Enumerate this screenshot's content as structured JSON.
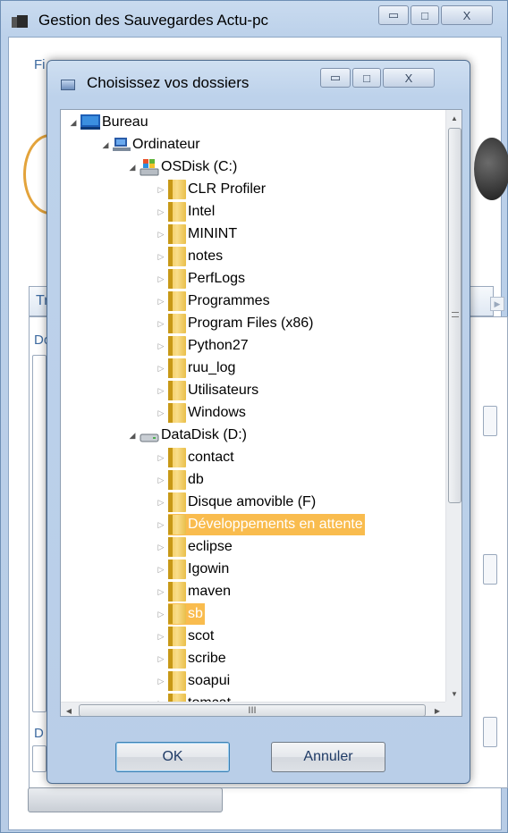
{
  "main_window": {
    "title": "Gestion des Sauvegardes Actu-pc",
    "menu_fragment": "Fi",
    "tab_fragment": "Tr",
    "label_fragment_1": "Do",
    "label_fragment_2": "D",
    "window_buttons": {
      "minimize": "▭",
      "maximize": "□",
      "close": "X"
    }
  },
  "dialog": {
    "title": "Choisissez vos dossiers",
    "window_buttons": {
      "minimize": "▭",
      "maximize": "□",
      "close": "X"
    },
    "ok_label": "OK",
    "cancel_label": "Annuler",
    "hscroll_grip": "III",
    "tree": {
      "root": "Bureau",
      "computer": "Ordinateur",
      "drive_c": "OSDisk (C:)",
      "drive_c_folders": [
        "CLR Profiler",
        "Intel",
        "MININT",
        "notes",
        "PerfLogs",
        "Programmes",
        "Program Files (x86)",
        "Python27",
        "ruu_log",
        "Utilisateurs",
        "Windows"
      ],
      "drive_d": "DataDisk (D:)",
      "drive_d_folders": [
        "contact",
        "db",
        "Disque amovible (F)",
        "Développements en attente",
        "eclipse",
        "Igowin",
        "maven",
        "sb",
        "scot",
        "scribe",
        "soapui",
        "tomcat"
      ]
    }
  },
  "colors": {
    "selection": "#f9bc4e",
    "window_frame": "#bcd1ea",
    "accent_text": "#3d6aa0"
  }
}
